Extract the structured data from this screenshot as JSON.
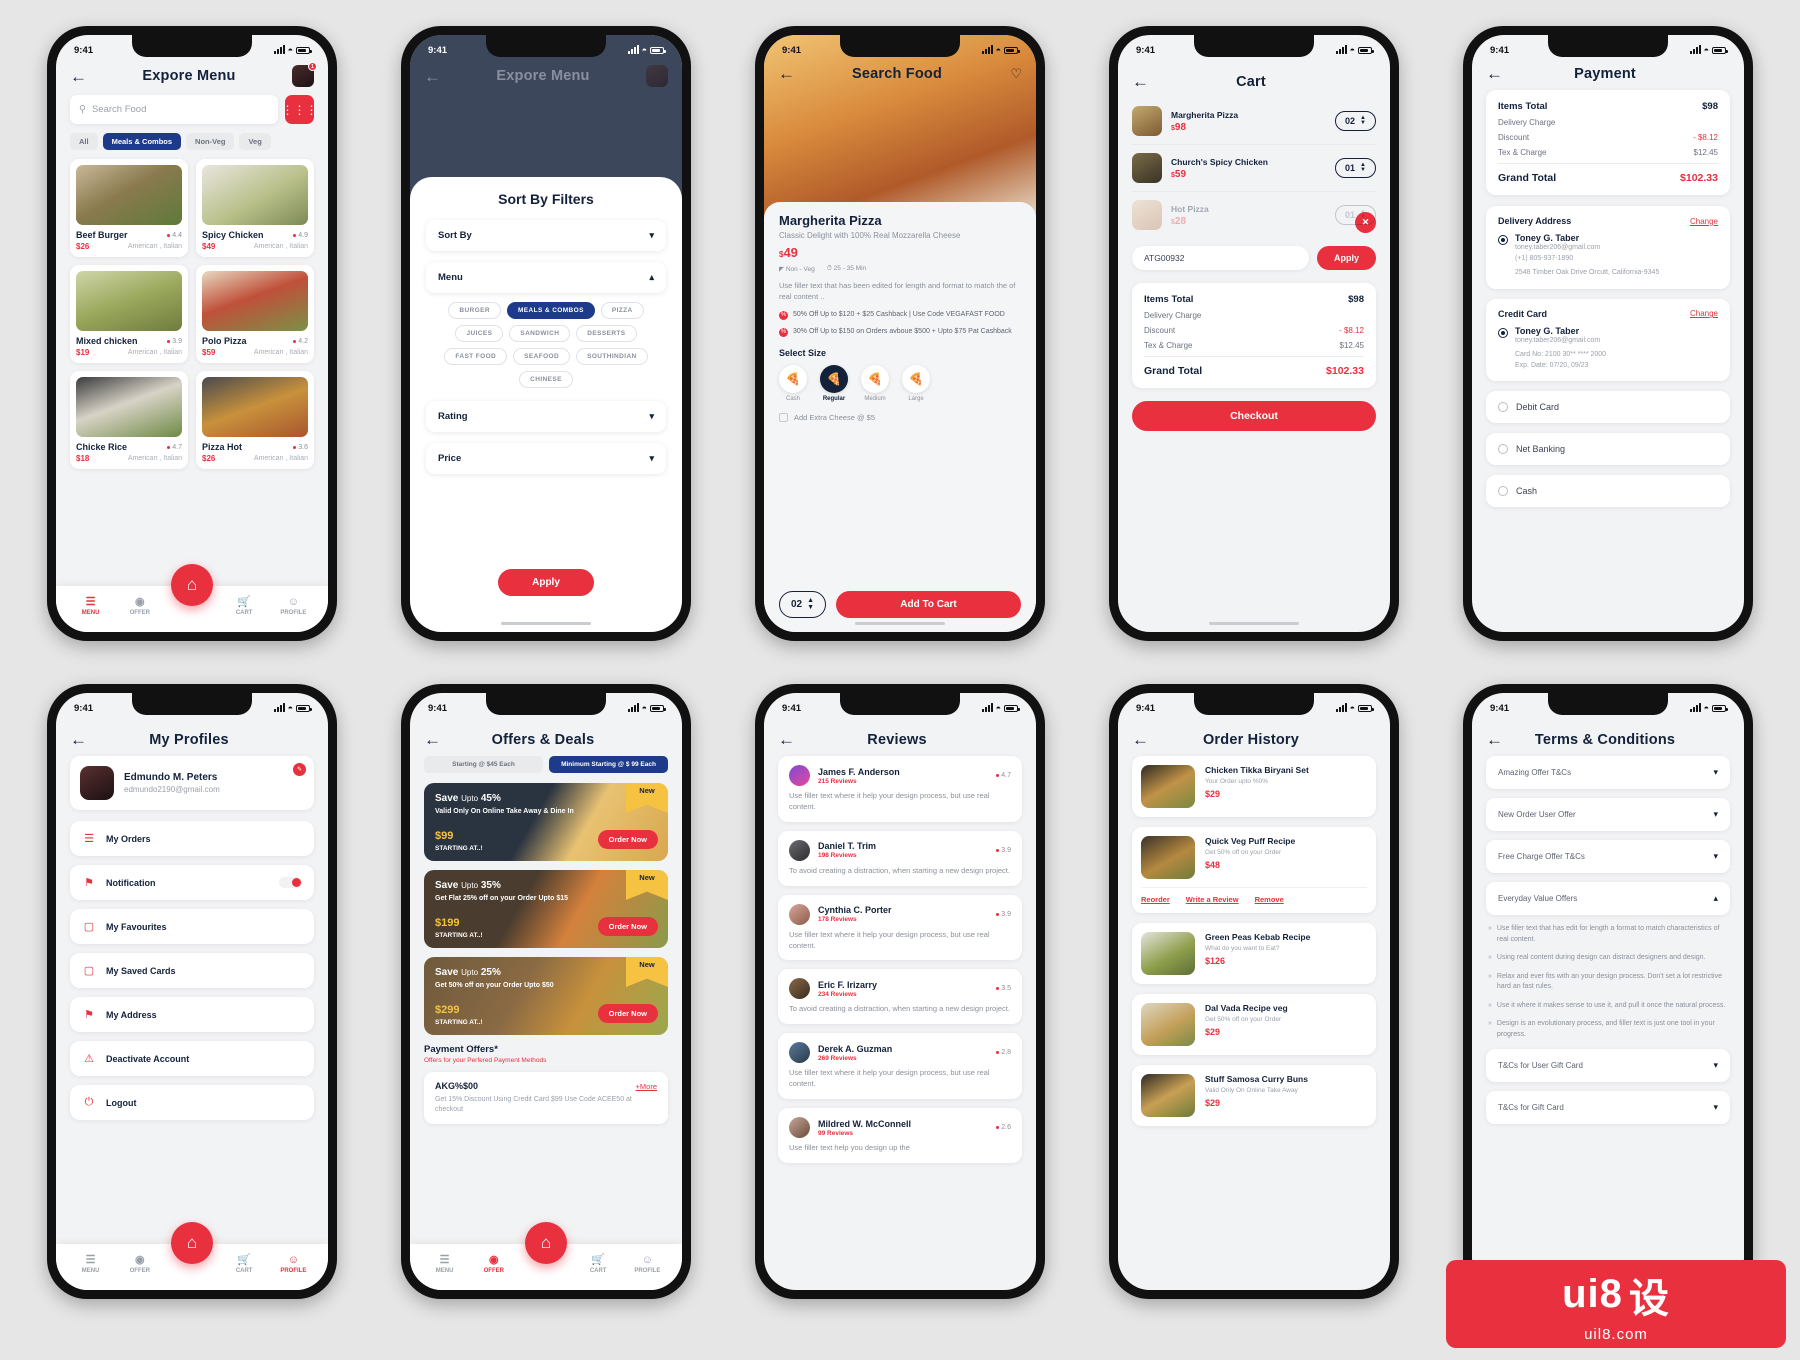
{
  "status_bar": {
    "time": "9:41"
  },
  "brand": {
    "red": "#e8303f",
    "navy": "#13213a",
    "blue": "#1e3a8a",
    "gold": "#f5c242"
  },
  "screen1": {
    "title": "Expore Menu",
    "search_placeholder": "Search Food",
    "chips": [
      "All",
      "Meals & Combos",
      "Non-Veg",
      "Veg"
    ],
    "active_chip": "Meals & Combos",
    "foods": [
      {
        "name": "Beef Burger",
        "rating": "4.4",
        "price": "$26",
        "cuisine": "American  ,  Italian"
      },
      {
        "name": "Spicy Chicken",
        "rating": "4.9",
        "price": "$49",
        "cuisine": "American  ,  Italian"
      },
      {
        "name": "Mixed chicken",
        "rating": "3.9",
        "price": "$19",
        "cuisine": "American  ,  Italian"
      },
      {
        "name": "Polo Pizza",
        "rating": "4.2",
        "price": "$59",
        "cuisine": "American  ,  Italian"
      },
      {
        "name": "Chicke Rice",
        "rating": "4.7",
        "price": "$18",
        "cuisine": "American  ,  Italian"
      },
      {
        "name": "Pizza Hot",
        "rating": "3.6",
        "price": "$26",
        "cuisine": "American  ,  Italian"
      }
    ],
    "nav": [
      "MENU",
      "OFFER",
      "CART",
      "PROFILE"
    ],
    "nav_active": "MENU",
    "badge": "1"
  },
  "screen2": {
    "title": "Expore Menu",
    "sheet_title": "Sort By Filters",
    "accordions": [
      {
        "label": "Sort By",
        "open": false
      },
      {
        "label": "Menu",
        "open": true
      },
      {
        "label": "Rating",
        "open": false
      },
      {
        "label": "Price",
        "open": false
      }
    ],
    "tags": [
      "BURGER",
      "MEALS & COMBOS",
      "PIZZA",
      "JUICES",
      "SANDWICH",
      "DESSERTS",
      "FAST FOOD",
      "SEAFOOD",
      "SOUTHINDIAN",
      "CHINESE"
    ],
    "active_tag": "MEALS & COMBOS",
    "apply_label": "Apply"
  },
  "screen3": {
    "title": "Search Food",
    "product_name": "Margherita Pizza",
    "product_sub": "Classic Delight with 100% Real Mozzarella Cheese",
    "price": "49",
    "currency": "$",
    "flag_veg": "Non - Veg",
    "flag_time": "25 - 35 Min",
    "description": "Use filler text that has been edited for length and format to match the of real content ..",
    "offers": [
      "50% Off Up to $120 + $25 Cashback | Use Code VEGAFAST FOOD",
      "30% Off Up to $150 on Orders avboue $500 + Upto $75 Pat Cashback"
    ],
    "size_label": "Select Size",
    "sizes": [
      "Cash",
      "Regular",
      "Medium",
      "Large"
    ],
    "active_size": "Regular",
    "extra_label": "Add Extra Cheese @ $5",
    "qty": "02",
    "add_to_cart": "Add To Cart"
  },
  "screen4": {
    "title": "Cart",
    "items": [
      {
        "name": "Margherita Pizza",
        "price": "98",
        "qty": "02",
        "faded": false
      },
      {
        "name": "Church's Spicy Chicken",
        "price": "59",
        "qty": "01",
        "faded": false
      },
      {
        "name": "Hot Pizza",
        "price": "28",
        "qty": "01",
        "faded": true
      }
    ],
    "promo_code": "ATG00932",
    "apply_label": "Apply",
    "totals": [
      {
        "label": "Items Total",
        "value": "$98",
        "head": true
      },
      {
        "label": "Delivery Charge",
        "value": "",
        "head": false
      },
      {
        "label": "Discount",
        "value": "- $8.12",
        "head": false
      },
      {
        "label": "Tex & Charge",
        "value": "$12.45",
        "head": false
      }
    ],
    "grand_label": "Grand Total",
    "grand_value": "$102.33",
    "checkout": "Checkout"
  },
  "screen5": {
    "title": "Payment",
    "totals": [
      {
        "label": "Items Total",
        "value": "$98",
        "head": true
      },
      {
        "label": "Delivery Charge",
        "value": "",
        "head": false
      },
      {
        "label": "Discount",
        "value": "- $8.12",
        "head": false
      },
      {
        "label": "Tex & Charge",
        "value": "$12.45",
        "head": false
      }
    ],
    "grand_label": "Grand Total",
    "grand_value": "$102.33",
    "address_head": "Delivery Address",
    "change": "Change",
    "address_name": "Toney G. Taber",
    "address_mail": "toney.taber206@gmail.com",
    "address_phone": "(+1) 805-937-1890",
    "address_line": "2548 Timber Oak Drive Orcutt, California-9345",
    "card_head": "Credit Card",
    "card_name": "Toney G. Taber",
    "card_mail": "toney.taber206@gmail.com",
    "card_no": "Card No: 2100 30** **** 2000",
    "card_exp": "Exp. Date: 07/20, 09/23",
    "options": [
      "Debit Card",
      "Net Banking",
      "Cash"
    ]
  },
  "screen6": {
    "title": "My Profiles",
    "user_name": "Edmundo M. Peters",
    "user_mail": "edmundo2190@gmail.com",
    "menu": [
      {
        "label": "My Orders",
        "icon": "☰",
        "toggle": false
      },
      {
        "label": "Notification",
        "icon": "⚑",
        "toggle": true
      },
      {
        "label": "My Favourites",
        "icon": "☷",
        "toggle": false
      },
      {
        "label": "My Saved Cards",
        "icon": "☷",
        "toggle": false
      },
      {
        "label": "My Address",
        "icon": "⚑",
        "toggle": false
      },
      {
        "label": "Deactivate Account",
        "icon": "⦸",
        "toggle": false
      },
      {
        "label": "Logout",
        "icon": "⏻",
        "toggle": false
      }
    ],
    "nav": [
      "MENU",
      "OFFER",
      "CART",
      "PROFILE"
    ],
    "nav_active": "PROFILE"
  },
  "screen7": {
    "title": "Offers & Deals",
    "tabs": [
      "Starting @ $45 Each",
      "Minimum Starting @ $ 99 Each"
    ],
    "active_tab": "Minimum Starting @ $ 99 Each",
    "banners": [
      {
        "save": "Save",
        "upto": "Upto",
        "pct": "45%",
        "sub": "Valid Only On Online Take Away & Dine In",
        "price": "$99",
        "starting": "STARTING AT..!",
        "order": "Order Now",
        "new": "New"
      },
      {
        "save": "Save",
        "upto": "Upto",
        "pct": "35%",
        "sub": "Get Flat 25% off on your Order Upto $15",
        "price": "$199",
        "starting": "STARTING AT..!",
        "order": "Order Now",
        "new": "New"
      },
      {
        "save": "Save",
        "upto": "Upto",
        "pct": "25%",
        "sub": "Get 50% off on your Order Upto $50",
        "price": "$299",
        "starting": "STARTING AT..!",
        "order": "Order Now",
        "new": "New"
      }
    ],
    "payoff_title": "Payment Offers*",
    "payoff_sub": "Offers for your Perfered Payment Methods",
    "code_name": "AKG%$00",
    "code_more": "+More",
    "code_desc": "Get 15% Discount Using Credit Card $99 Use Code ACEE50 at checkout",
    "nav": [
      "MENU",
      "OFFER",
      "CART",
      "PROFILE"
    ],
    "nav_active": "OFFER"
  },
  "screen8": {
    "title": "Reviews",
    "reviews": [
      {
        "name": "James F. Anderson",
        "count": "215 Reviews",
        "rating": "4.7",
        "text": "Use filler text where it help your design process, but use real content."
      },
      {
        "name": "Daniel T. Trim",
        "count": "198 Reviews",
        "rating": "3.9",
        "text": "To avoid creating a distraction, when starting a new design project."
      },
      {
        "name": "Cynthia C. Porter",
        "count": "178 Reviews",
        "rating": "3.9",
        "text": "Use filler text where it help your design process, but use real content."
      },
      {
        "name": "Eric F. Irizarry",
        "count": "234 Reviews",
        "rating": "3.5",
        "text": "To avoid creating a distraction, when starting a new design project."
      },
      {
        "name": "Derek A. Guzman",
        "count": "269 Reviews",
        "rating": "2.8",
        "text": "Use filler text where it help your design process, but use real content."
      },
      {
        "name": "Mildred W. McConnell",
        "count": "99 Reviews",
        "rating": "2.6",
        "text": "Use filler text help you design up the"
      }
    ]
  },
  "screen9": {
    "title": "Order History",
    "orders": [
      {
        "name": "Chicken Tikka Biryani Set",
        "sub": "Your Order upto %0%",
        "price": "$29",
        "actions": []
      },
      {
        "name": "Quick Veg Puff Recipe",
        "sub": "Get 50% off on your Order",
        "price": "$48",
        "actions": [
          "Reorder",
          "Write a Review",
          "Remove"
        ]
      },
      {
        "name": "Green Peas Kebab Recipe",
        "sub": "What do you want to Eat?",
        "price": "$126",
        "actions": []
      },
      {
        "name": "Dal Vada Recipe veg",
        "sub": "Get 50% off on your Order",
        "price": "$29",
        "actions": []
      },
      {
        "name": "Stuff Samosa Curry Buns",
        "sub": "Valid Only On Online Take Away",
        "price": "$29",
        "actions": []
      }
    ]
  },
  "screen10": {
    "title": "Terms & Conditions",
    "sections_top": [
      {
        "label": "Amazing Offer T&Cs",
        "open": false
      },
      {
        "label": "New Order User Offer",
        "open": false
      },
      {
        "label": "Free Charge Offer T&Cs",
        "open": false
      },
      {
        "label": "Everyday Value Offers",
        "open": true
      }
    ],
    "bullets": [
      "Use filler text that has edit for length a format to match characteristics of real content.",
      "Using real content during design can distract designers and design.",
      "Relax and ever fits with an your design process. Don't set a lot restrictive hard an fast rules.",
      "Use it where it makes sense to use it, and pull it once the natural process.",
      "Design is an evolutionary process, and filler text is just one tool in your progress."
    ],
    "sections_bottom": [
      {
        "label": "T&Cs for User Gift Card",
        "open": false
      },
      {
        "label": "T&Cs for Gift Card",
        "open": false
      }
    ]
  },
  "watermark": {
    "top": "ui8",
    "cn": "设",
    "bottom": "uil8.com"
  }
}
